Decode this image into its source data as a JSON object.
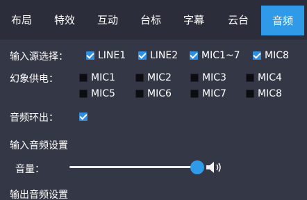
{
  "tabs": [
    {
      "label": "布局",
      "active": false
    },
    {
      "label": "特效",
      "active": false
    },
    {
      "label": "互动",
      "active": false
    },
    {
      "label": "台标",
      "active": false
    },
    {
      "label": "字幕",
      "active": false
    },
    {
      "label": "云台",
      "active": false
    },
    {
      "label": "音频",
      "active": true
    }
  ],
  "input_source": {
    "label": "输入源选择：",
    "options": [
      {
        "label": "LINE1",
        "checked": true
      },
      {
        "label": "LINE2",
        "checked": true
      },
      {
        "label": "MIC1~7",
        "checked": true
      },
      {
        "label": "MIC8",
        "checked": true
      }
    ]
  },
  "phantom_power": {
    "label": "幻象供电：",
    "options": [
      {
        "label": "MIC1",
        "checked": false
      },
      {
        "label": "MIC2",
        "checked": false
      },
      {
        "label": "MIC3",
        "checked": false
      },
      {
        "label": "MIC4",
        "checked": false
      },
      {
        "label": "MIC5",
        "checked": false
      },
      {
        "label": "MIC6",
        "checked": false
      },
      {
        "label": "MIC7",
        "checked": false
      },
      {
        "label": "MIC8",
        "checked": false
      }
    ]
  },
  "audio_loop": {
    "label": "音频环出：",
    "checked": true
  },
  "input_audio": {
    "title": "输入音频设置",
    "volume_label": "音量：",
    "volume_value": 1.0,
    "icon": "speaker-icon"
  },
  "output_audio": {
    "title": "输出音频设置"
  },
  "colors": {
    "accent": "#2f9ae8",
    "background": "#343846",
    "tabbar": "#2b2e3a"
  }
}
